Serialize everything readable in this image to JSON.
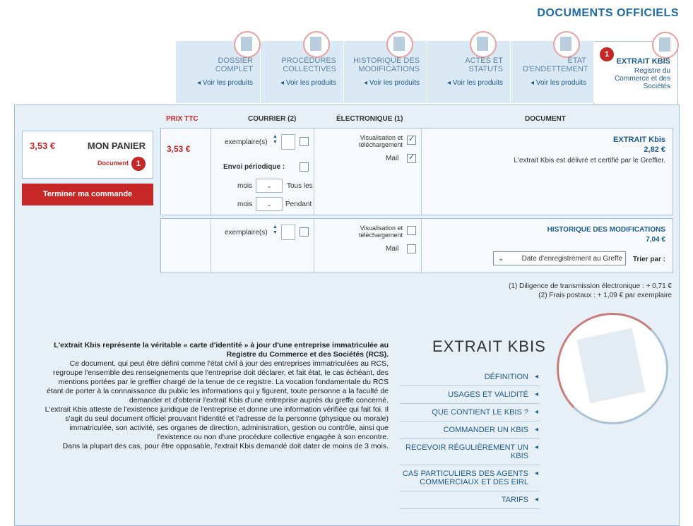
{
  "page_title": "DOCUMENTS OFFICIELS",
  "tabs": [
    {
      "label": "EXTRAIT KBIS",
      "sub": "Registre du Commerce et des Sociétés",
      "badge": "1",
      "active": true
    },
    {
      "label": "ÉTAT D'ENDETTEMENT",
      "link": "Voir les produits"
    },
    {
      "label": "ACTES ET STATUTS",
      "link": "Voir les produits"
    },
    {
      "label": "HISTORIQUE DES MODIFICATIONS",
      "link": "Voir les produits"
    },
    {
      "label": "PROCÉDURES COLLECTIVES",
      "link": "Voir les produits"
    },
    {
      "label": "DOSSIER COMPLET",
      "link": "Voir les produits"
    }
  ],
  "table_headers": {
    "document": "DOCUMENT",
    "electronique": "ÉLECTRONIQUE (1)",
    "courrier": "COURRIER (2)",
    "prix": "PRIX TTC"
  },
  "rows": [
    {
      "name": "EXTRAIT Kbis",
      "price": "2,82 €",
      "desc": "L'extrait Kbis est délivré et certifié par le Greffier.",
      "opt_visualisation": "Visualisation et téléchargement",
      "opt_mail": "Mail",
      "exemplaires": "exemplaire(s)",
      "envoi": "Envoi périodique :",
      "tous_les": "Tous les",
      "pendant": "Pendant",
      "mois1": "mois",
      "mois2": "mois",
      "total": "3,53 €"
    },
    {
      "name": "HISTORIQUE DES MODIFICATIONS",
      "price": "7,04 €",
      "trier_label": "Trier par :",
      "trier_value": "Date d'enregistrement au Greffe",
      "opt_visualisation": "Visualisation et téléchargement",
      "opt_mail": "Mail",
      "exemplaires": "exemplaire(s)"
    }
  ],
  "basket": {
    "title": "MON PANIER",
    "total": "3,53 €",
    "count": "1",
    "count_label": "Document",
    "button": "Terminer ma commande"
  },
  "notes": [
    "(1) Diligence de transmission électronique : + 0,71 €",
    "(2) Frais postaux : + 1,09 € par exemplaire"
  ],
  "kbis_section": {
    "title": "EXTRAIT KBIS",
    "menu": [
      "DÉFINITION",
      "USAGES ET VALIDITÉ",
      "QUE CONTIENT LE KBIS ?",
      "COMMANDER UN KBIS",
      "RECEVOIR RÉGULIÈREMENT UN KBIS",
      "CAS PARTICULIERS DES AGENTS COMMERCIAUX ET DES EIRL",
      "TARIFS"
    ],
    "paragraphs": [
      "L'extrait Kbis représente la véritable « carte d'identité » à jour d'une entreprise immatriculée au Registre du Commerce et des Sociétés (RCS).",
      "Ce document, qui peut être défini comme l'état civil à jour des entreprises immatriculées au RCS, regroupe l'ensemble des renseignements que l'entreprise doit déclarer, et fait état, le cas échéant, des mentions portées par le greffier chargé de la tenue de ce registre. La vocation fondamentale du RCS étant de porter à la connaissance du public les informations qui y figurent, toute personne a la faculté de demander et d'obtenir l'extrait Kbis d'une entreprise auprès du greffe concerné.",
      "L'extrait Kbis atteste de l'existence juridique de l'entreprise et donne une information vérifiée qui fait foi. Il s'agit du seul document officiel prouvant l'identité et l'adresse de la personne (physique ou morale) immatriculée, son activité, ses organes de direction, administration, gestion ou contrôle, ainsi que l'existence ou non d'une procédure collective engagée à son encontre.",
      "Dans la plupart des cas, pour être opposable, l'extrait Kbis demandé doit dater de moins de 3 mois."
    ]
  }
}
